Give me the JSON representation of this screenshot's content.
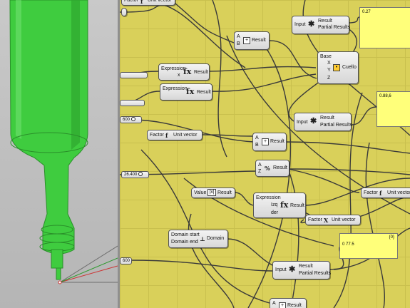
{
  "labels": {
    "result": "Result",
    "partial_results": "Partial Results",
    "input": "Input",
    "a": "A",
    "b": "B",
    "base": "Base",
    "x": "X",
    "y": "Y",
    "z": "Z",
    "cuello": "Cuello",
    "expression": "Expression",
    "factor": "Factor",
    "unit_vector": "Unit vector",
    "value": "Value",
    "izq": "Izq",
    "der": "der",
    "domain_start": "Domain start",
    "domain_end": "Domain end",
    "domain": "Domain",
    "x_small": "x"
  },
  "sliders": {
    "s1": "600",
    "s2": "26.400",
    "s3": "600"
  },
  "panels": {
    "p1_value": "0.27",
    "p2_value": "0.88,6",
    "p3_value": "0 77.5",
    "p3_index": "{0}"
  },
  "colors": {
    "canvas": "#d9d05a",
    "panel": "#ffff7a",
    "bottle": "#3fcc3f",
    "viewport_bg": "#c4c4c4"
  },
  "icons": [
    "fx-icon",
    "mass-addition-icon",
    "addition-icon",
    "construct-point-icon",
    "unit-vector-icon",
    "absolute-value-icon",
    "construct-domain-icon",
    "negative-icon"
  ]
}
